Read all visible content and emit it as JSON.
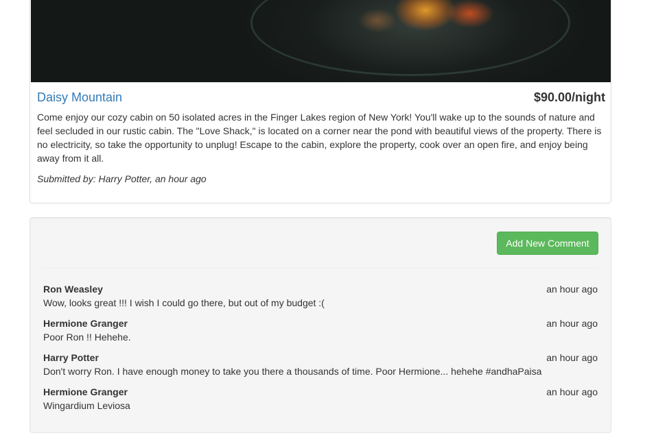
{
  "campground": {
    "name": "Daisy Mountain",
    "price": "$90.00/night",
    "description": "Come enjoy our cozy cabin on 50 isolated acres in the Finger Lakes region of New York! You'll wake up to the sounds of nature and feel secluded in our rustic cabin. The \"Love Shack,\" is located on a corner near the pond with beautiful views of the property. There is no electricity, so take the opportunity to unplug! Escape to the cabin, explore the property, cook over an open fire, and enjoy being away from it all.",
    "submitted_by": "Submitted by: Harry Potter, an hour ago"
  },
  "comments_section": {
    "add_button_label": "Add New Comment",
    "comments": [
      {
        "author": "Ron Weasley",
        "time": "an hour ago",
        "text": "Wow, looks great !!! I wish I could go there, but out of my budget :("
      },
      {
        "author": "Hermione Granger",
        "time": "an hour ago",
        "text": "Poor Ron !! Hehehe."
      },
      {
        "author": "Harry Potter",
        "time": "an hour ago",
        "text": "Don't worry Ron. I have enough money to take you there a thousands of time. Poor Hermione... hehehe #andhaPaisa"
      },
      {
        "author": "Hermione Granger",
        "time": "an hour ago",
        "text": "Wingardium Leviosa"
      }
    ]
  },
  "colors": {
    "link": "#337ab7",
    "success_button": "#5cb85c",
    "well_background": "#f5f5f5"
  }
}
